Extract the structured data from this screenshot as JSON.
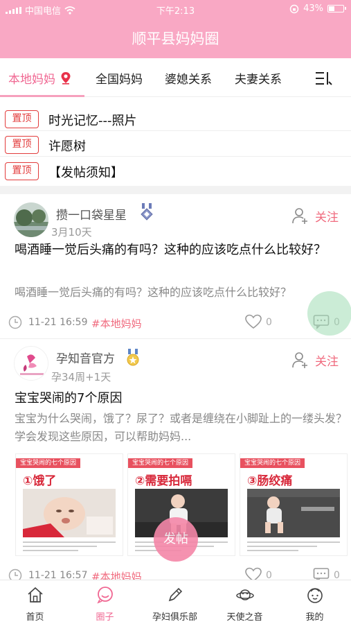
{
  "status_bar": {
    "carrier": "中国电信",
    "time": "下午2:13",
    "battery": "43%"
  },
  "header": {
    "title": "顺平县妈妈圈"
  },
  "tabs": [
    {
      "label": "本地妈妈",
      "active": true
    },
    {
      "label": "全国妈妈"
    },
    {
      "label": "婆媳关系"
    },
    {
      "label": "夫妻关系"
    }
  ],
  "pinned": [
    {
      "badge": "置顶",
      "text": "时光记忆---照片"
    },
    {
      "badge": "置顶",
      "text": "许愿树"
    },
    {
      "badge": "置顶",
      "text": "【发帖须知】"
    }
  ],
  "posts": [
    {
      "author": "攒一口袋星星",
      "sub": "3月10天",
      "follow": "关注",
      "title": "喝酒睡一觉后头痛的有吗？这种的应该吃点什么比较好？",
      "body": "喝酒睡一觉后头痛的有吗？这种的应该吃点什么比较好？",
      "time": "11-21 16:59",
      "tag": "#本地妈妈",
      "likes": "0",
      "comments": "0"
    },
    {
      "author": "孕知音官方",
      "sub": "孕34周+1天",
      "follow": "关注",
      "title": "宝宝哭闹的7个原因",
      "body": "宝宝为什么哭闹，饿了？尿了？或者是缠绕在小脚趾上的一缕头发？学会发现这些原因，可以帮助妈妈...",
      "images": [
        {
          "header": "宝宝哭闹的七个原因",
          "heading": "①饿了"
        },
        {
          "header": "宝宝哭闹的七个原因",
          "heading": "②需要拍嗝"
        },
        {
          "header": "宝宝哭闹的七个原因",
          "heading": "③肠绞痛"
        }
      ],
      "time": "11-21 16:57",
      "tag": "#本地妈妈",
      "likes": "0",
      "comments": "0"
    }
  ],
  "fab_label": "发帖",
  "bottom_nav": [
    {
      "label": "首页",
      "icon": "home-icon"
    },
    {
      "label": "圈子",
      "icon": "circle-chat-icon",
      "active": true
    },
    {
      "label": "孕妇俱乐部",
      "icon": "pencil-icon"
    },
    {
      "label": "天使之音",
      "icon": "planet-icon"
    },
    {
      "label": "我的",
      "icon": "baby-face-icon"
    }
  ],
  "colors": {
    "brand_pink": "#f9a8c4",
    "accent": "#f06792",
    "pin_red": "#e23b3b"
  }
}
